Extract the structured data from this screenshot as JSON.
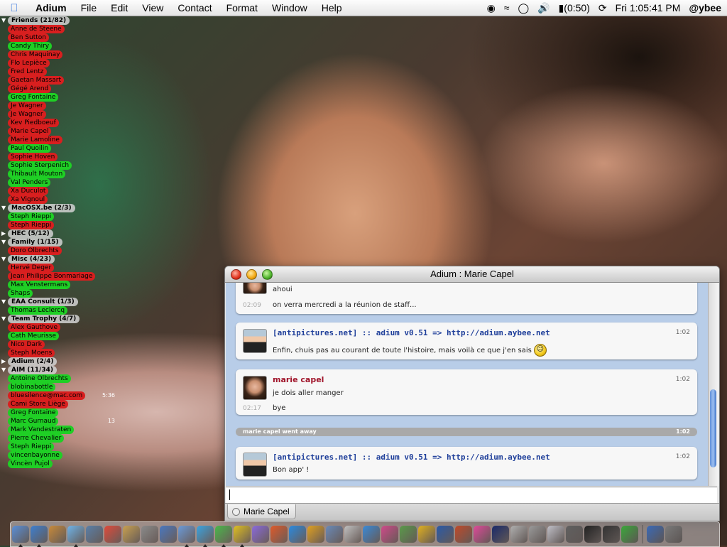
{
  "menubar": {
    "app_name": "Adium",
    "menus": [
      "File",
      "Edit",
      "View",
      "Contact",
      "Format",
      "Window",
      "Help"
    ],
    "battery": "(0:50)",
    "clock": "Fri 1:05:41 PM",
    "user": "@ybee"
  },
  "contacts": {
    "groups": [
      {
        "label": "Friends (21/82)",
        "items": [
          {
            "name": "Anne de Steene",
            "status": "red"
          },
          {
            "name": "Ben Sutton",
            "status": "red"
          },
          {
            "name": "Candy Thiry",
            "status": "green"
          },
          {
            "name": "Chris Maquinay",
            "status": "red"
          },
          {
            "name": "Flo Lepièce",
            "status": "red"
          },
          {
            "name": "Fred Lentz",
            "status": "red"
          },
          {
            "name": "Gaetan Massart",
            "status": "red"
          },
          {
            "name": "Gégé Arend",
            "status": "red"
          },
          {
            "name": "Greg Fontaine",
            "status": "green"
          },
          {
            "name": "Je Wagner",
            "status": "red"
          },
          {
            "name": "Je Wagner",
            "status": "red"
          },
          {
            "name": "Kev Piedboeuf",
            "status": "red"
          },
          {
            "name": "Marie Capel",
            "status": "red"
          },
          {
            "name": "Marie Lamoline",
            "status": "red"
          },
          {
            "name": "Paul Quoilin",
            "status": "green"
          },
          {
            "name": "Sophie Hoven",
            "status": "red"
          },
          {
            "name": "Sophie Sterpenich",
            "status": "green"
          },
          {
            "name": "Thibault Mouton",
            "status": "green"
          },
          {
            "name": "Val Penders",
            "status": "green"
          },
          {
            "name": "Xa Duculot",
            "status": "red"
          },
          {
            "name": "Xa Vignoul",
            "status": "red"
          }
        ]
      },
      {
        "label": "MacOSX.be (2/3)",
        "items": [
          {
            "name": "Steph Rieppi",
            "status": "green"
          },
          {
            "name": "Steph Rieppi",
            "status": "red"
          }
        ]
      },
      {
        "label": "HEC (5/12)",
        "items": []
      },
      {
        "label": "Family (1/15)",
        "items": [
          {
            "name": "Doro Olbrechts",
            "status": "red"
          }
        ]
      },
      {
        "label": "Misc (4/23)",
        "items": [
          {
            "name": "Hervé Deger",
            "status": "red"
          },
          {
            "name": "Jean Philippe Bonmariage",
            "status": "red"
          },
          {
            "name": "Max Venstermans",
            "status": "green"
          },
          {
            "name": "Shaps",
            "status": "green"
          }
        ]
      },
      {
        "label": "EAA Consult (1/3)",
        "items": [
          {
            "name": "Thomas Leclercq",
            "status": "green"
          }
        ]
      },
      {
        "label": "Team Trophy (4/7)",
        "items": [
          {
            "name": "Alex Gauthove",
            "status": "red"
          },
          {
            "name": "Cath Meurisse",
            "status": "green"
          },
          {
            "name": "Nico Dark",
            "status": "red"
          },
          {
            "name": "Steph Moens",
            "status": "red"
          }
        ]
      },
      {
        "label": "Adium (2/4)",
        "items": []
      },
      {
        "label": "AIM (11/34)",
        "items": [
          {
            "name": "Antoine Olbrechts",
            "status": "green"
          },
          {
            "name": "blobinabottle",
            "status": "green"
          },
          {
            "name": "bluesilence@mac.com",
            "status": "red",
            "idle": "5:36"
          },
          {
            "name": "Cami Store Liège",
            "status": "red"
          },
          {
            "name": "Greg Fontaine",
            "status": "green"
          },
          {
            "name": "Marc Gurnaud",
            "status": "green",
            "idle": "13"
          },
          {
            "name": "Mark Vandestraten",
            "status": "green"
          },
          {
            "name": "Pierre Chevalier",
            "status": "green"
          },
          {
            "name": "Steph Rieppi",
            "status": "green"
          },
          {
            "name": "vincenbayonne",
            "status": "green"
          },
          {
            "name": "Vincèn Pujol",
            "status": "green"
          }
        ]
      }
    ]
  },
  "chat": {
    "title": "Adium : Marie Capel",
    "messages": [
      {
        "text": "ahoui",
        "subtime": "02:09",
        "subtext": "on verra mercredi a la réunion de staff..."
      },
      {
        "sender": "[antipictures.net] :: adium v0.51 => http://adium.aybee.net",
        "time": "1:02",
        "text": "Enfin, chuis pas au courant de toute l'histoire, mais voilà ce que j'en sais"
      },
      {
        "sender": "marie capel",
        "time": "1:02",
        "text": "je dois aller manger",
        "subtime": "02:17",
        "subtext": "bye"
      },
      {
        "sender": "[antipictures.net] :: adium v0.51 => http://adium.aybee.net",
        "time": "1:02",
        "text": "Bon app' !"
      }
    ],
    "status_line": {
      "text": "marie capel went away",
      "time": "1:02"
    },
    "tab_label": "Marie Capel",
    "smiley": "☺"
  },
  "dock": {
    "icons": [
      "finder-icon",
      "ie-icon",
      "guitar-icon",
      "itunes-icon",
      "iphoto-icon",
      "ical-icon",
      "addressbook-icon",
      "calculator-icon",
      "preview-icon",
      "mail-icon",
      "ichat-icon",
      "msn-icon",
      "aim-icon",
      "sherlock-icon",
      "network-icon",
      "safari-icon",
      "road-icon",
      "archive-icon",
      "documents-icon",
      "books-icon",
      "pictures-icon",
      "css-icon",
      "tools-icon",
      "photoshop-icon",
      "rocket-icon",
      "flower-icon",
      "star-icon",
      "scissors-icon",
      "stethoscope-icon",
      "apple-icon",
      "print-icon",
      "terminal-icon",
      "console-icon",
      "frog-icon",
      "docs-icon",
      "trash-icon"
    ]
  }
}
